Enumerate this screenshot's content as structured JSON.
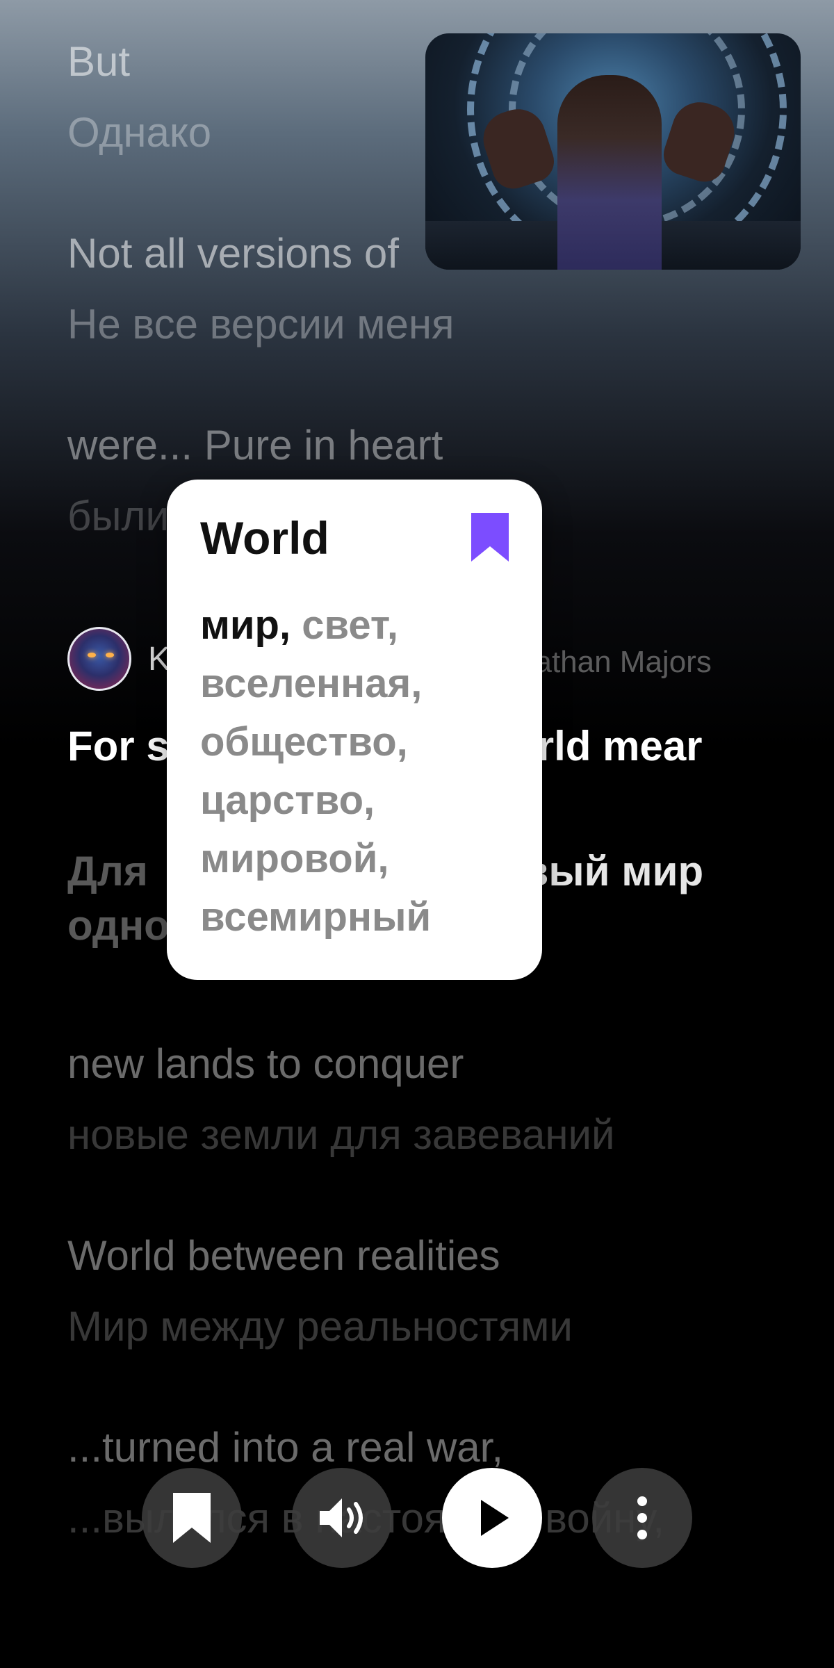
{
  "lyrics_before": [
    {
      "en": "But",
      "ru": "Однако"
    },
    {
      "en": "Not all versions of",
      "ru": "Не все версии меня"
    },
    {
      "en": "were... Pure in heart",
      "ru": "были чисты сердцем"
    }
  ],
  "speaker": {
    "name": "K",
    "actor": "nathan Majors"
  },
  "active": {
    "en": "For s                       w world mear",
    "ru_prefix": "Для                        с, ",
    "ru_highlight": "новый мир",
    "ru_suffix": "                    одно,"
  },
  "lyrics_after": [
    {
      "en": "new lands to conquer",
      "ru": "новые земли для завеваний"
    },
    {
      "en": "World between realities",
      "ru": "Мир между реальностями"
    },
    {
      "en": "...turned into a real war,",
      "ru": "...вылился в настоящую войну,"
    }
  ],
  "popup": {
    "word": "World",
    "primary_translation": "мир,",
    "translations": "свет, вселенная, общество, царство, мировой, всемирный",
    "bookmark_color": "#7c4dff"
  },
  "controls": {
    "bookmark": "bookmark-icon",
    "audio": "speaker-icon",
    "play": "play-icon",
    "more": "more-vertical-icon"
  }
}
